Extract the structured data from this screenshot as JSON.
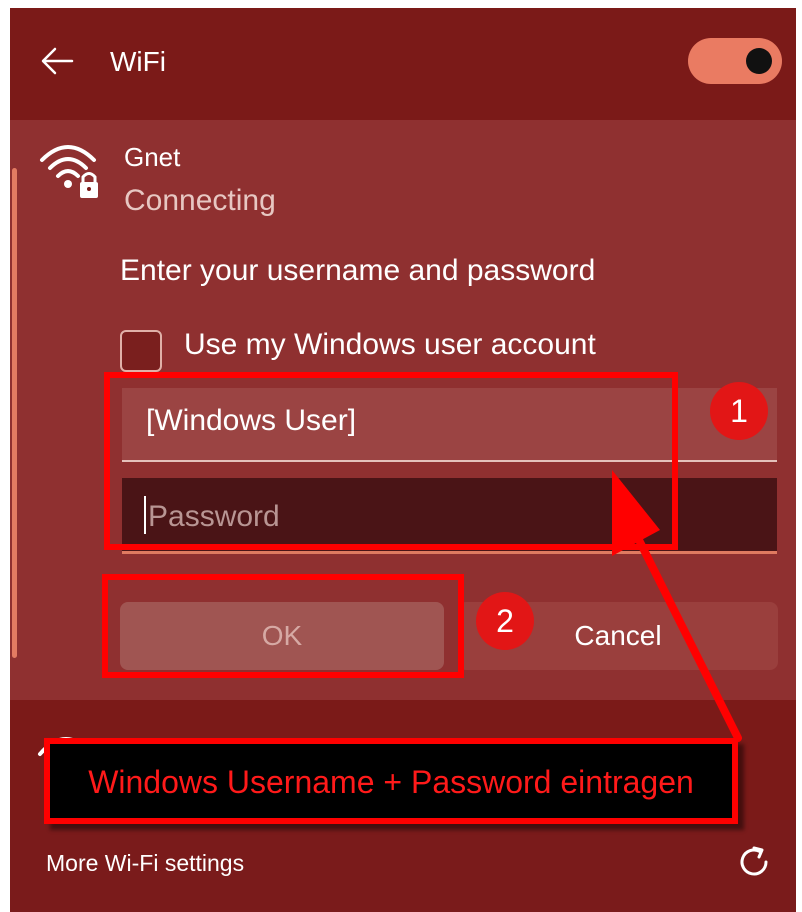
{
  "header": {
    "title": "WiFi",
    "wifi_enabled": true
  },
  "network": {
    "name": "Gnet",
    "status": "Connecting",
    "instruction": "Enter your username and password",
    "use_windows_account_label": "Use my Windows user account",
    "use_windows_account_checked": false,
    "username_value": "[Windows User]",
    "password_placeholder": "Password",
    "ok_label": "OK",
    "cancel_label": "Cancel"
  },
  "footer": {
    "more_settings_label": "More Wi-Fi settings"
  },
  "annotations": {
    "badge_1": "1",
    "badge_2": "2",
    "callout": "Windows Username + Password eintragen",
    "color": "#ff0000"
  },
  "icons": [
    "back-arrow-icon",
    "wifi-lock-icon",
    "refresh-icon"
  ],
  "colors": {
    "panel": "#7b1a18",
    "card": "#8f3030",
    "accent": "#ea7b62"
  }
}
